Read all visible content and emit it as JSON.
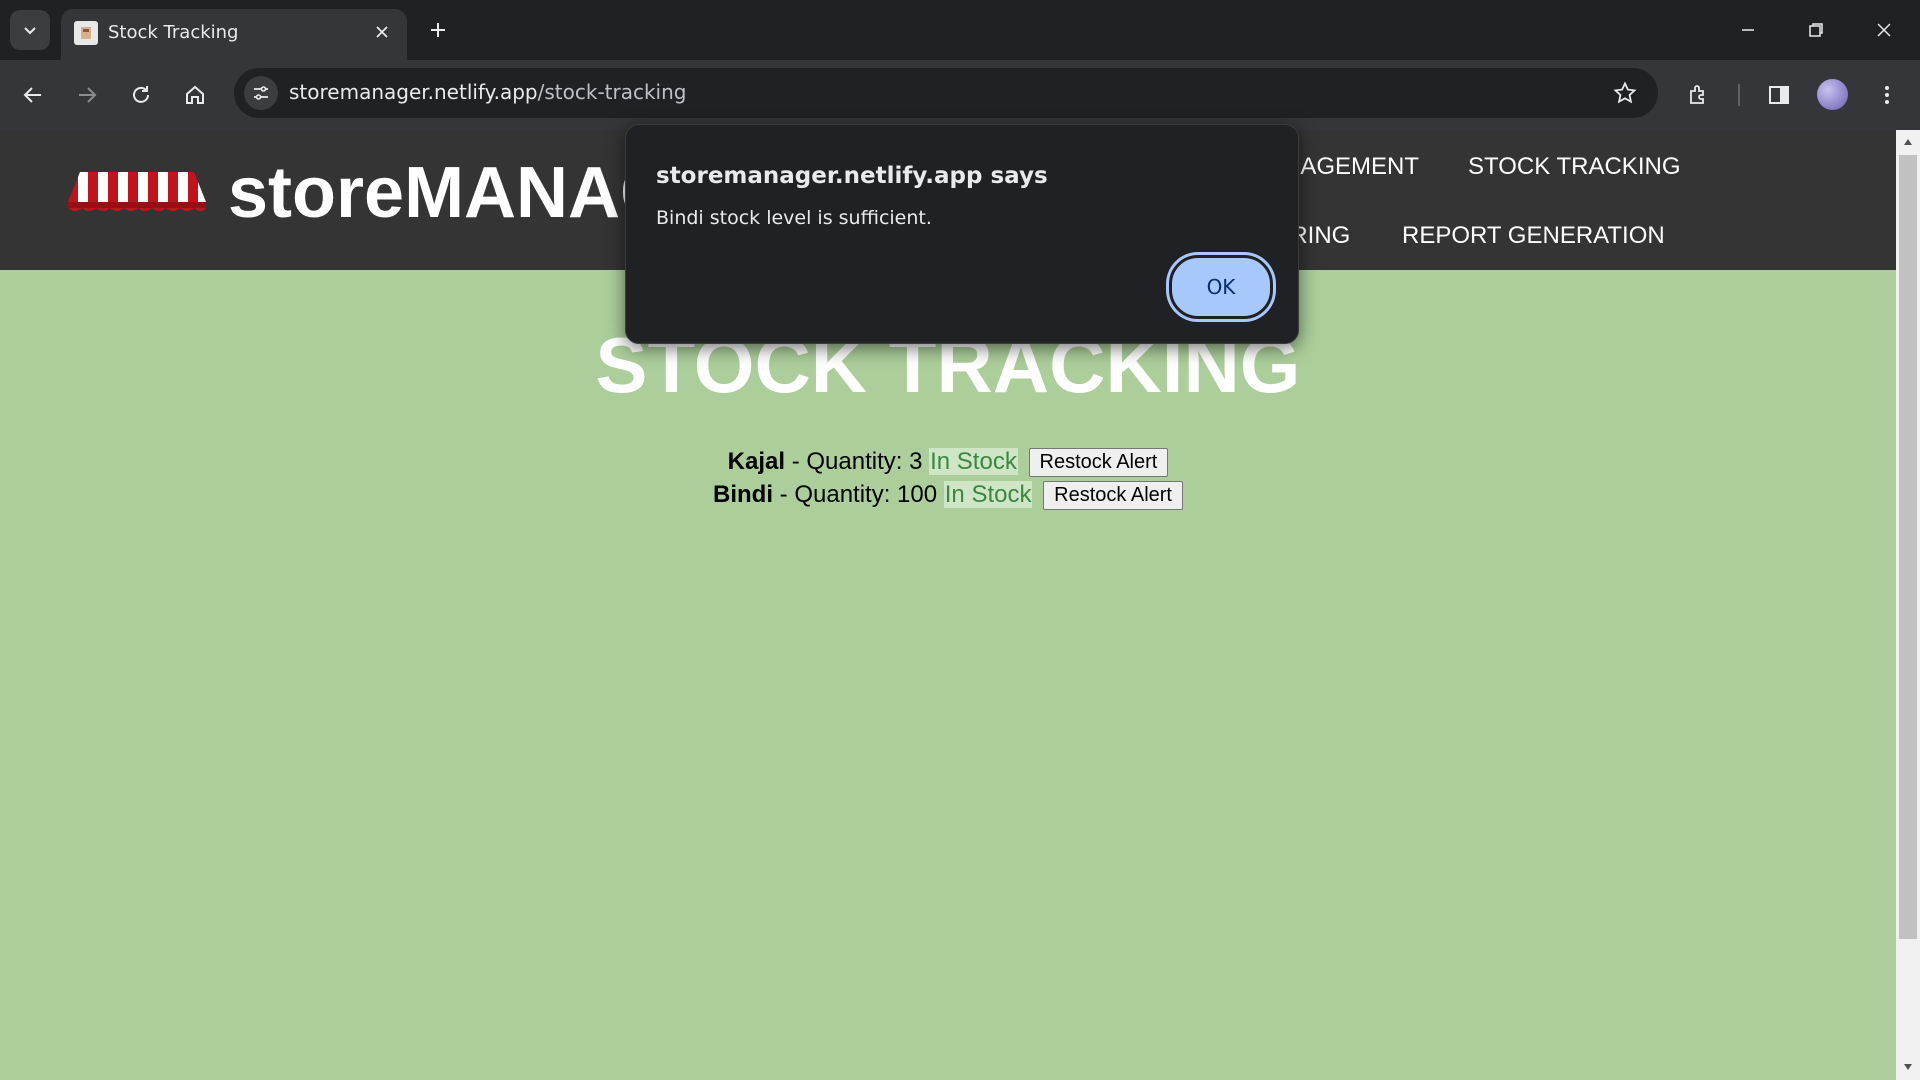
{
  "browser": {
    "tab_title": "Stock Tracking",
    "url_host": "storemanager.netlify.app",
    "url_path": "/stock-tracking"
  },
  "header": {
    "brand": "storeMANAGER",
    "nav": [
      "MANAGEMENT",
      "STOCK TRACKING",
      "ORDERING",
      "REPORT GENERATION"
    ]
  },
  "main": {
    "title": "STOCK TRACKING",
    "items": [
      {
        "name": "Kajal",
        "quantity_text": " - Quantity: 3 ",
        "status": "In Stock",
        "button": "Restock Alert"
      },
      {
        "name": "Bindi",
        "quantity_text": " - Quantity: 100 ",
        "status": "In Stock",
        "button": "Restock Alert"
      }
    ]
  },
  "dialog": {
    "title": "storemanager.netlify.app says",
    "message": "Bindi stock level is sufficient.",
    "ok": "OK"
  },
  "colors": {
    "page_bg": "#abce9a",
    "header_bg": "#343434",
    "status_green": "#3c8740",
    "dialog_bg": "#202124",
    "ok_button": "#a8c7fa"
  }
}
